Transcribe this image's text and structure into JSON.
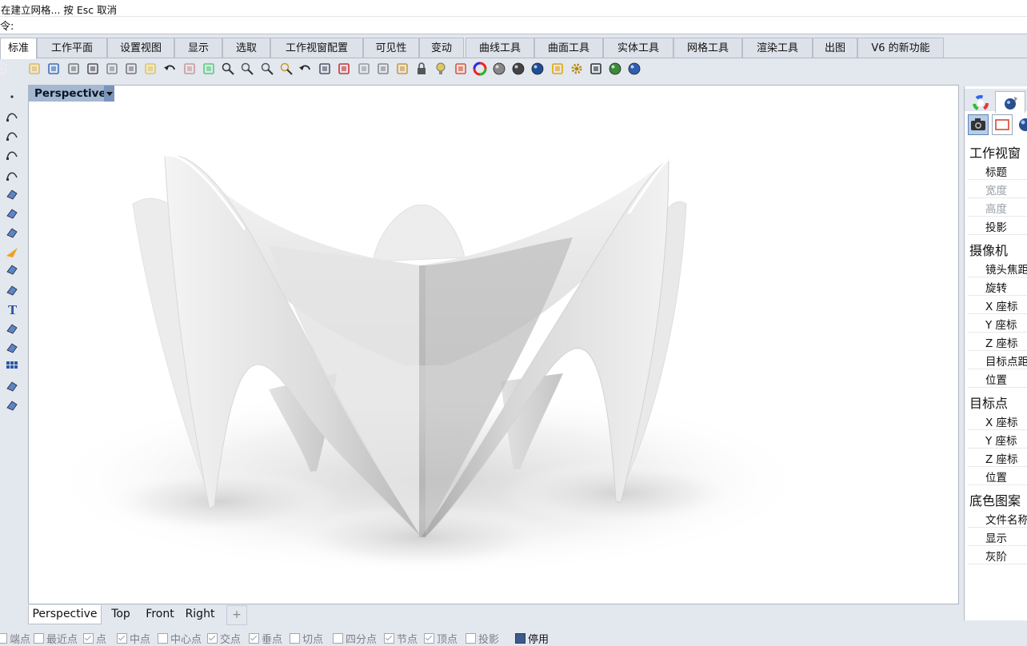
{
  "command_area": {
    "prompt_line": "在建立网格... 按 Esc 取消",
    "command_label": "令:"
  },
  "tabs": [
    {
      "label": "标准",
      "active": true
    },
    {
      "label": "工作平面"
    },
    {
      "label": "设置视图"
    },
    {
      "label": "显示"
    },
    {
      "label": "选取"
    },
    {
      "label": "工作视窗配置"
    },
    {
      "label": "可见性"
    },
    {
      "label": "变动"
    },
    {
      "label": "曲线工具"
    },
    {
      "label": "曲面工具"
    },
    {
      "label": "实体工具"
    },
    {
      "label": "网格工具"
    },
    {
      "label": "渲染工具"
    },
    {
      "label": "出图"
    },
    {
      "label": "V6 的新功能"
    }
  ],
  "viewport": {
    "title": "Perspective"
  },
  "view_tabs": [
    "Perspective",
    "Top",
    "Front",
    "Right"
  ],
  "add_tab_glyph": "+",
  "snaps": [
    {
      "label": "端点",
      "checked": false
    },
    {
      "label": "最近点",
      "checked": false
    },
    {
      "label": "点",
      "checked": true
    },
    {
      "label": "中点",
      "checked": true
    },
    {
      "label": "中心点",
      "checked": false
    },
    {
      "label": "交点",
      "checked": true
    },
    {
      "label": "垂点",
      "checked": true
    },
    {
      "label": "切点",
      "checked": false
    },
    {
      "label": "四分点",
      "checked": false
    },
    {
      "label": "节点",
      "checked": true
    },
    {
      "label": "顶点",
      "checked": true
    },
    {
      "label": "投影",
      "checked": false
    },
    {
      "label": "停用",
      "checked": true
    }
  ],
  "properties": {
    "sections": [
      {
        "title": "工作视窗",
        "items": [
          {
            "label": "标题"
          },
          {
            "label": "宽度",
            "gray": true
          },
          {
            "label": "高度",
            "gray": true
          },
          {
            "label": "投影"
          }
        ]
      },
      {
        "title": "摄像机",
        "items": [
          {
            "label": "镜头焦距"
          },
          {
            "label": "旋转"
          },
          {
            "label": "X 座标"
          },
          {
            "label": "Y 座标"
          },
          {
            "label": "Z 座标"
          },
          {
            "label": "目标点距"
          },
          {
            "label": "位置"
          }
        ]
      },
      {
        "title": "目标点",
        "items": [
          {
            "label": "X 座标"
          },
          {
            "label": "Y 座标"
          },
          {
            "label": "Z 座标"
          },
          {
            "label": "位置"
          }
        ]
      },
      {
        "title": "底色图案",
        "items": [
          {
            "label": "文件名称"
          },
          {
            "label": "显示"
          },
          {
            "label": "灰阶"
          }
        ]
      }
    ]
  },
  "colors": {
    "accent_viewport_label": "#a5b8d2",
    "selected_button": "#b6cde8"
  }
}
